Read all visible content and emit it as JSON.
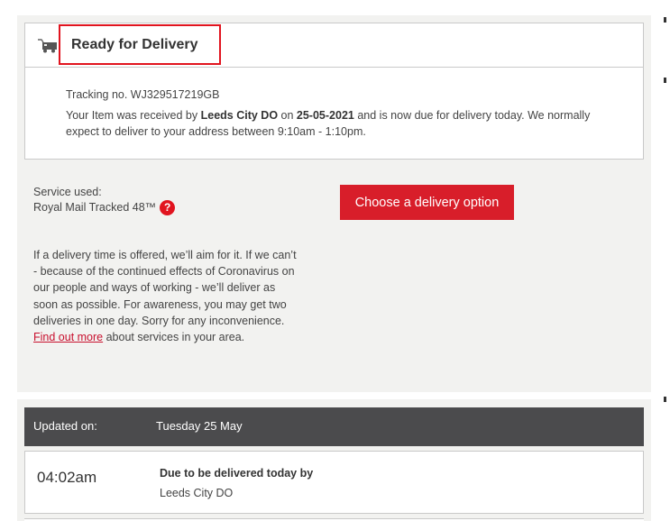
{
  "status": {
    "title": "Ready for Delivery",
    "icon": "delivery-van-icon",
    "tracking_line": "Tracking no. WJ329517219GB",
    "message_pre": "Your Item was received by ",
    "office": "Leeds City DO",
    "message_mid": " on ",
    "date": "25-05-2021",
    "message_post": " and is now due for delivery today. We normally expect to deliver to your address between 9:10am - 1:10pm."
  },
  "service": {
    "label": "Service used:",
    "name": "Royal Mail Tracked 48™",
    "help_glyph": "?"
  },
  "info": {
    "text": "If a delivery time is offered, we’ll aim for it. If we can’t - because of the continued effects of Coronavirus on our people and ways of working - we’ll deliver as soon as possible. For awareness, you may get two deliveries in one day. Sorry for any inconvenience. ",
    "link": "Find out more",
    "suffix": " about services in your area."
  },
  "action": {
    "button_label": "Choose a delivery option"
  },
  "history": {
    "updated_label": "Updated on:",
    "updated_date": "Tuesday 25 May",
    "events": [
      {
        "time": "04:02am",
        "title": "Due to be delivered today by",
        "place": "Leeds City DO"
      }
    ]
  },
  "colors": {
    "accent": "#d81e2a",
    "header_bar": "#4b4b4d",
    "panel": "#f2f2f0"
  }
}
